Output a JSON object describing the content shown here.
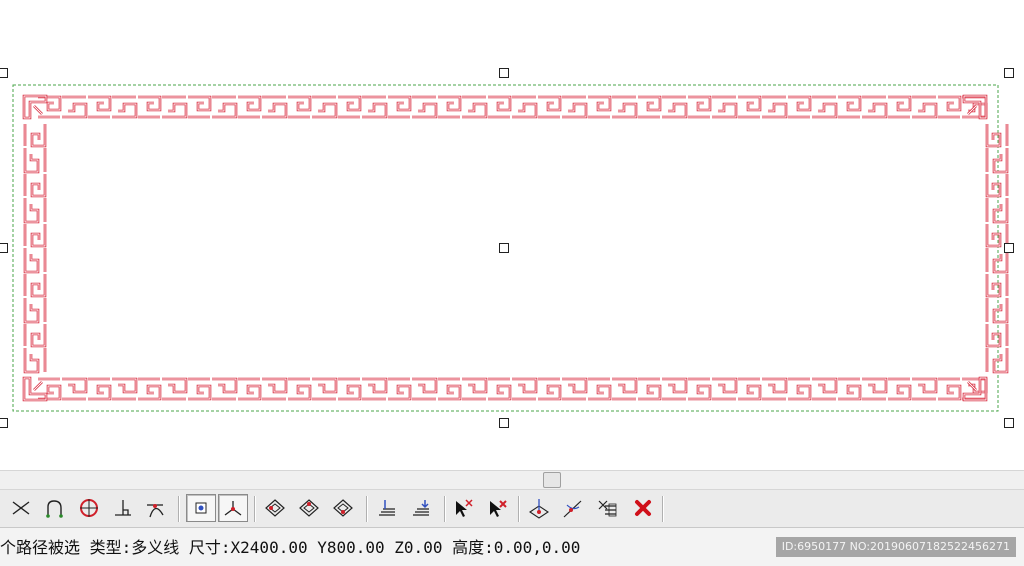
{
  "canvas": {
    "pattern_color": "#d8283c",
    "frame_color": "#4aa64a",
    "shape_type": "fret-border"
  },
  "toolbar": {
    "buttons": [
      {
        "name": "intersect-tool",
        "icon": "cross-lines-icon"
      },
      {
        "name": "arc-fillet-tool",
        "icon": "arc-icon"
      },
      {
        "name": "circle-center-tool",
        "icon": "circle-target-icon"
      },
      {
        "name": "perpendicular-tool",
        "icon": "perpendicular-icon"
      },
      {
        "name": "tangent-tool",
        "icon": "tangent-icon"
      },
      {
        "name": "snap-point-tool",
        "icon": "snap-point-icon"
      },
      {
        "name": "angle-tool",
        "icon": "angle-icon"
      },
      {
        "name": "diamond-node-1-tool",
        "icon": "diamond-node-icon"
      },
      {
        "name": "diamond-node-2-tool",
        "icon": "diamond-node-icon"
      },
      {
        "name": "diamond-node-3-tool",
        "icon": "diamond-node-icon"
      },
      {
        "name": "layer-tool",
        "icon": "layer-icon"
      },
      {
        "name": "layer-down-tool",
        "icon": "layer-down-icon"
      },
      {
        "name": "pointer-add-tool",
        "icon": "pointer-add-icon"
      },
      {
        "name": "pointer-remove-tool",
        "icon": "pointer-remove-icon"
      },
      {
        "name": "plane-node-tool",
        "icon": "plane-node-icon"
      },
      {
        "name": "curve-node-tool",
        "icon": "curve-node-icon"
      },
      {
        "name": "list-edit-tool",
        "icon": "list-edit-icon"
      },
      {
        "name": "delete-tool",
        "icon": "red-x-icon"
      }
    ]
  },
  "status": {
    "text": "个路径被选 类型:多义线 尺寸:X2400.00 Y800.00 Z0.00 高度:0.00,0.00"
  },
  "watermark": {
    "text": "ID:6950177 NO:20190607182522456271"
  }
}
